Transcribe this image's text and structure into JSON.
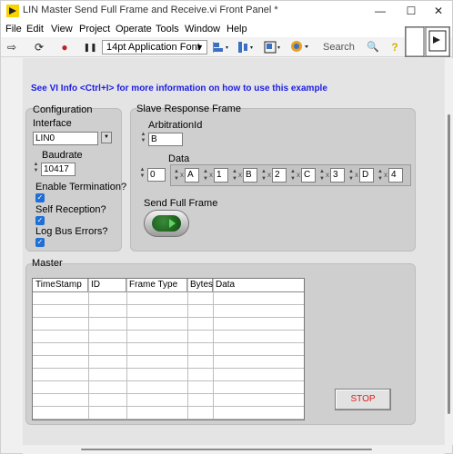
{
  "window": {
    "title": "LIN Master Send Full Frame and Receive.vi Front Panel *",
    "minimize_glyph": "—",
    "maximize_glyph": "☐",
    "close_glyph": "✕"
  },
  "menu": [
    "File",
    "Edit",
    "View",
    "Project",
    "Operate",
    "Tools",
    "Window",
    "Help"
  ],
  "toolbar": {
    "run_glyph": "⇨",
    "run_continuous_glyph": "⟳",
    "abort_glyph": "●",
    "pause_glyph": "❚❚",
    "font": "14pt Application Font",
    "search_placeholder": "Search",
    "search_glyph": "🔍",
    "help_glyph": "?"
  },
  "info_text": "See VI Info <Ctrl+I> for more information on how to use this example",
  "configuration": {
    "title": "Configuration",
    "interface_label": "Interface",
    "interface_value": "LIN0",
    "baudrate_label": "Baudrate",
    "baudrate_value": "10417",
    "enable_termination_label": "Enable Termination?",
    "self_reception_label": "Self Reception?",
    "log_bus_errors_label": "Log Bus Errors?",
    "enable_termination": true,
    "self_reception": true,
    "log_bus_errors": true,
    "check_glyph": "✓"
  },
  "slave_response": {
    "title": "Slave Response Frame",
    "arbitration_label": "ArbitrationId",
    "arbitration_value": "B",
    "data_label": "Data",
    "data_index": "0",
    "data_values": [
      "A",
      "1",
      "B",
      "2",
      "C",
      "3",
      "D",
      "4"
    ],
    "data_prefix": "x",
    "send_label": "Send Full Frame"
  },
  "master": {
    "title": "Master",
    "columns": [
      "TimeStamp",
      "ID",
      "Frame Type",
      "Bytes",
      "Data"
    ]
  },
  "stop_label": "STOP",
  "colors": {
    "info_link": "#1c1ce6",
    "stop_text": "#e01b1b",
    "checkbox": "#1e6fd8",
    "panel_bg": "#e4e4e4",
    "cluster_bg": "#cfcfcf"
  }
}
